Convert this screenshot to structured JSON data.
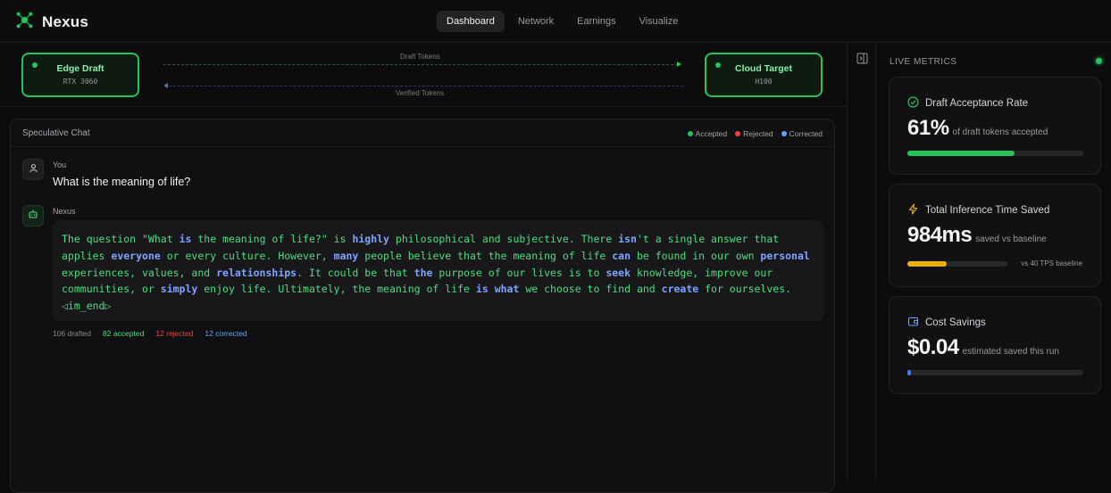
{
  "app": {
    "name": "Nexus"
  },
  "nav": {
    "tabs": [
      {
        "label": "Dashboard",
        "active": true
      },
      {
        "label": "Network",
        "active": false
      },
      {
        "label": "Earnings",
        "active": false
      },
      {
        "label": "Visualize",
        "active": false
      }
    ]
  },
  "pipeline": {
    "edge": {
      "title": "Edge Draft",
      "device": "RTX 3060"
    },
    "cloud": {
      "title": "Cloud Target",
      "device": "H100"
    },
    "draft_label": "Draft Tokens",
    "verified_label": "Verified Tokens"
  },
  "chat": {
    "title": "Speculative Chat",
    "legend": {
      "accepted": "Accepted",
      "rejected": "Rejected",
      "corrected": "Corrected"
    },
    "user": {
      "name": "You",
      "message": "What is the meaning of life?"
    },
    "assistant": {
      "name": "Nexus",
      "end_token": "◁im_end▷",
      "lines": [
        [
          [
            "a",
            "The question \"What "
          ],
          [
            "c",
            "is"
          ],
          [
            "a",
            " the meaning of life?\" is "
          ],
          [
            "c",
            "highly"
          ],
          [
            "a",
            " philosophical and subjective. There "
          ],
          [
            "c",
            "isn"
          ],
          [
            "a",
            "'t a single answer that"
          ]
        ],
        [
          [
            "a",
            "applies "
          ],
          [
            "c",
            "everyone"
          ],
          [
            "a",
            " or every culture. However, "
          ],
          [
            "c",
            "many"
          ],
          [
            "a",
            " people believe that the meaning of life "
          ],
          [
            "c",
            "can"
          ],
          [
            "a",
            " be found in our own "
          ],
          [
            "c",
            "personal"
          ]
        ],
        [
          [
            "a",
            "experiences, values, and "
          ],
          [
            "c",
            "relationships"
          ],
          [
            "a",
            ". It could be that "
          ],
          [
            "c",
            "the"
          ],
          [
            "a",
            " purpose of our lives is to "
          ],
          [
            "c",
            "seek"
          ],
          [
            "a",
            " knowledge, improve our"
          ]
        ],
        [
          [
            "a",
            "communities, or "
          ],
          [
            "c",
            "simply"
          ],
          [
            "a",
            " enjoy life. Ultimately, the meaning of life "
          ],
          [
            "c",
            "is"
          ],
          [
            "a",
            " "
          ],
          [
            "c",
            "what"
          ],
          [
            "a",
            " we choose to find and "
          ],
          [
            "c",
            "create"
          ],
          [
            "a",
            " for ourselves."
          ]
        ]
      ]
    },
    "stats": {
      "drafted": "106 drafted",
      "accepted": "82 accepted",
      "rejected": "12 rejected",
      "corrected": "12 corrected"
    }
  },
  "metrics": {
    "title": "LIVE METRICS",
    "acceptance": {
      "label": "Draft Acceptance Rate",
      "value": "61%",
      "sub": "of draft tokens accepted",
      "fill": 0.61,
      "color": "#22c55e"
    },
    "time_saved": {
      "label": "Total Inference Time Saved",
      "value": "984ms",
      "sub": "saved vs baseline",
      "fill": 0.39,
      "color": "#eab308",
      "note": "vs 40 TPS baseline"
    },
    "cost": {
      "label": "Cost Savings",
      "value": "$0.04",
      "sub": "estimated saved this run",
      "fill": 0.02,
      "color": "#3b82f6"
    }
  },
  "colors": {
    "accepted": "#22c55e",
    "rejected": "#ef4444",
    "corrected": "#60a5fa"
  }
}
